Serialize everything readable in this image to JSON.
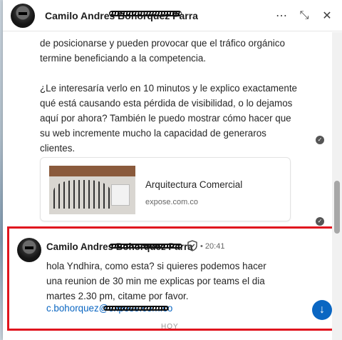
{
  "header": {
    "name": "Camilo Andres Bohorquez Parra",
    "actions": {
      "more": "⋯",
      "collapse": "⤡",
      "close": "✕"
    }
  },
  "previous_message": {
    "paragraph_1": "de posicionarse y pueden provocar que el tráfico orgánico termine beneficiando a la competencia.",
    "paragraph_2": "¿Le interesaría verlo en 10 minutos y le explico exactamente qué está causando esta pérdida de visibilidad, o lo dejamos aquí por ahora? También le puedo mostrar cómo hacer que su web incremente mucho la capacidad de generaros clientes.",
    "check": "✓"
  },
  "link_preview": {
    "title": "Arquitectura Comercial",
    "domain": "expose.com.co"
  },
  "last_message": {
    "sender": "Camilo Andres Bohorquez Parra",
    "time": "• 20:41",
    "text": "hola Yndhira, como esta? si quieres podemos hacer una reunion de 30 min me explicas por teams el dia martes 2.30 pm, citame por favor.",
    "email": "c.bohorquez@expose.com.co"
  },
  "day_divider": "HOY",
  "scroll_down_icon": "↓",
  "colors": {
    "highlight_border": "#e0141e",
    "link": "#0a66c2",
    "scroll_button": "#0a66c2"
  }
}
